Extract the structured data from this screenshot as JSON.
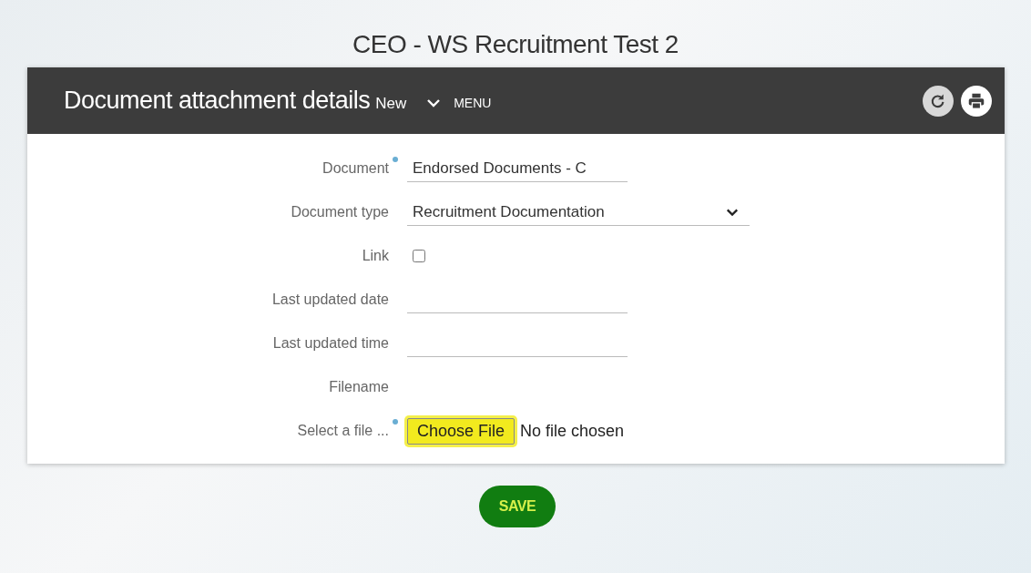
{
  "page_title": "CEO - WS Recruitment Test 2",
  "panel": {
    "title": "Document attachment details",
    "mode": "New",
    "menu_label": "MENU"
  },
  "fields": [
    {
      "kind": "text",
      "label": "Document",
      "required": true,
      "value": "Endorsed Documents - C"
    },
    {
      "kind": "select",
      "label": "Document type",
      "required": false,
      "value": "Recruitment Documentation"
    },
    {
      "kind": "checkbox",
      "label": "Link",
      "required": false,
      "checked": false
    },
    {
      "kind": "text",
      "label": "Last updated date",
      "required": false
    },
    {
      "kind": "text",
      "label": "Last updated time",
      "required": false
    },
    {
      "kind": "static",
      "label": "Filename",
      "required": false
    },
    {
      "kind": "file",
      "label": "Select a file ...",
      "required": true,
      "button_label": "Choose File",
      "highlighted": true,
      "status": "No file chosen"
    }
  ],
  "save_button": "SAVE"
}
